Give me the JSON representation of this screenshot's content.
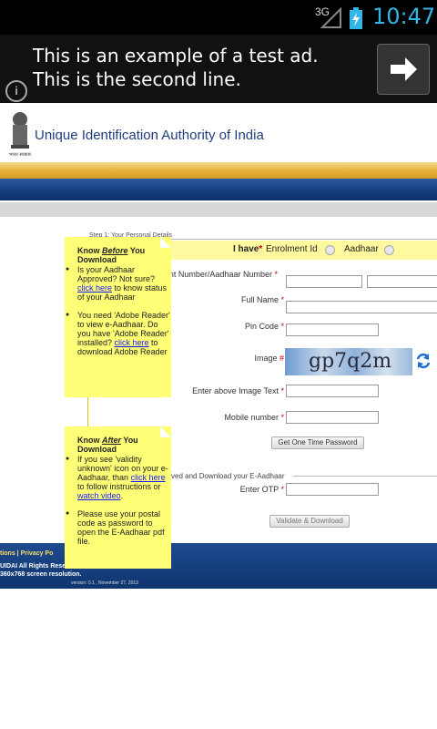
{
  "status_bar": {
    "network": "3G",
    "time": "10:47"
  },
  "ad": {
    "text": "This is an example of a test ad. This is the second line."
  },
  "header": {
    "org_name": "Unique Identification Authority of India",
    "logo_caption": "भारत सरकार"
  },
  "form": {
    "step_label": "Step 1: Your Personal Details",
    "i_have_label": "I have",
    "enrolment_option": "Enrolment Id",
    "aadhaar_option": "Aadhaar",
    "number_label": "nt Number/Aadhaar Number",
    "full_name_label": "Full Name",
    "pin_code_label": "Pin Code",
    "image_label": "Image",
    "captcha_text": "gp7q2m",
    "enter_image_text_label": "Enter above Image Text",
    "mobile_label": "Mobile number",
    "get_otp_button": "Get One Time Password",
    "step2_label": "ved and Download your E-Aadhaar",
    "otp_label": "Enter OTP",
    "validate_button": "Validate & Download"
  },
  "tooltip_before": {
    "title_prefix": "Know ",
    "title_em": "Before",
    "title_suffix": " You Download",
    "item1_text": "Is your Aadhaar Approved? Not sure? ",
    "item1_link": "click here",
    "item1_tail": " to know status of your Aadhaar",
    "item2_text": "You need 'Adobe Reader' to view e-Aadhaar. Do you have 'Adobe Reader' installed? ",
    "item2_link": "click here",
    "item2_tail": " to download Adobe Reader"
  },
  "tooltip_after": {
    "title_prefix": "Know ",
    "title_em": "After",
    "title_suffix": " You Download",
    "item1_text": "If you see 'validity unknown' icon on your e-Aadhaar, than ",
    "item1_link": "click here",
    "item1_mid": " to follow instructions or ",
    "item1_link2": "watch video",
    "item1_tail": ".",
    "item2_text": "Please use your postal code as password to open the E-Aadhaar pdf file."
  },
  "footer": {
    "links": "tions  |  Privacy Po",
    "rights": "UIDAI All Rights Rese",
    "resolution": "360x768 screen resolution.",
    "version": "version: 0.1 , November 27, 2013"
  },
  "colors": {
    "accent": "#33b5e5",
    "tooltip": "#ffff77",
    "header_text": "#1f3e80"
  }
}
